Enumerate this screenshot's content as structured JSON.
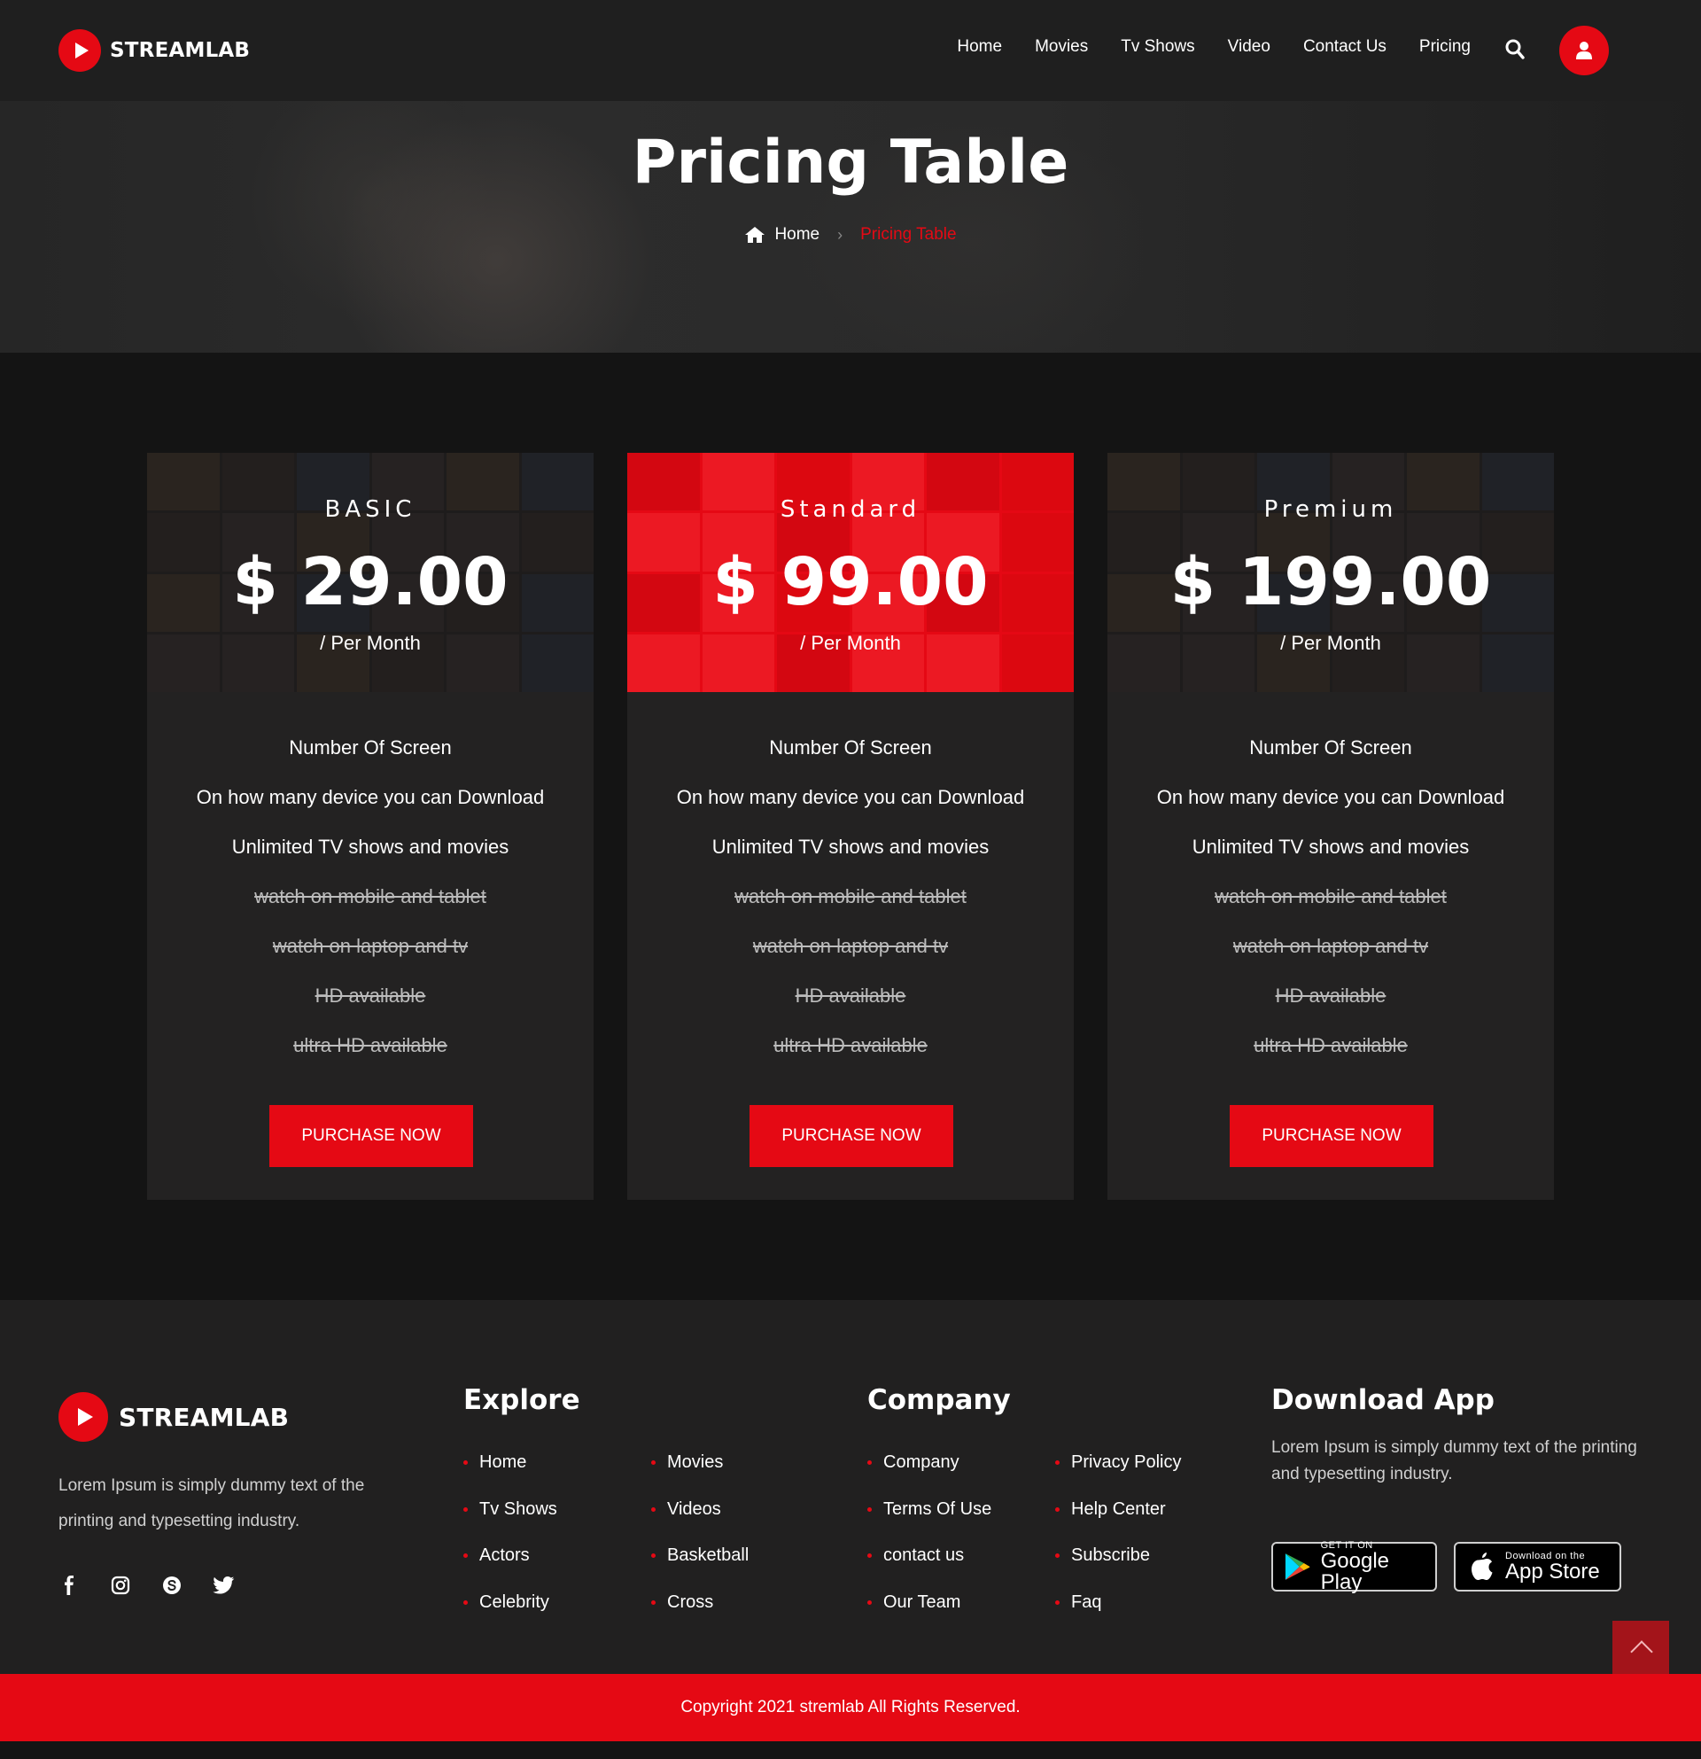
{
  "brand": {
    "name": "STREAMLAB"
  },
  "nav": {
    "items": [
      "Home",
      "Movies",
      "Tv Shows",
      "Video",
      "Contact Us",
      "Pricing"
    ]
  },
  "hero": {
    "title": "Pricing Table",
    "breadcrumb": {
      "home": "Home",
      "current": "Pricing Table"
    }
  },
  "plans": [
    {
      "name": "BASIC",
      "price": "$ 29.00",
      "period": "/ Per Month",
      "features": [
        {
          "text": "Number Of Screen",
          "enabled": true
        },
        {
          "text": "On how many device you can Download",
          "enabled": true
        },
        {
          "text": "Unlimited TV shows and movies",
          "enabled": true
        },
        {
          "text": "watch on mobile and tablet",
          "enabled": false
        },
        {
          "text": "watch on laptop and tv",
          "enabled": false
        },
        {
          "text": "HD available",
          "enabled": false
        },
        {
          "text": "ultra HD available",
          "enabled": false
        }
      ],
      "button": "PURCHASE NOW",
      "highlight": false
    },
    {
      "name": "Standard",
      "price": "$ 99.00",
      "period": "/ Per Month",
      "features": [
        {
          "text": "Number Of Screen",
          "enabled": true
        },
        {
          "text": "On how many device you can Download",
          "enabled": true
        },
        {
          "text": "Unlimited TV shows and movies",
          "enabled": true
        },
        {
          "text": "watch on mobile and tablet",
          "enabled": false
        },
        {
          "text": "watch on laptop and tv",
          "enabled": false
        },
        {
          "text": "HD available",
          "enabled": false
        },
        {
          "text": "ultra HD available",
          "enabled": false
        }
      ],
      "button": "PURCHASE NOW",
      "highlight": true
    },
    {
      "name": "Premium",
      "price": "$ 199.00",
      "period": "/ Per Month",
      "features": [
        {
          "text": "Number Of Screen",
          "enabled": true
        },
        {
          "text": "On how many device you can Download",
          "enabled": true
        },
        {
          "text": "Unlimited TV shows and movies",
          "enabled": true
        },
        {
          "text": "watch on mobile and tablet",
          "enabled": false
        },
        {
          "text": "watch on laptop and tv",
          "enabled": false
        },
        {
          "text": "HD available",
          "enabled": false
        },
        {
          "text": "ultra HD available",
          "enabled": false
        }
      ],
      "button": "PURCHASE NOW",
      "highlight": false
    }
  ],
  "footer": {
    "about": "Lorem Ipsum is simply dummy text of the printing and typesetting industry.",
    "socials": [
      "facebook-icon",
      "instagram-icon",
      "skype-icon",
      "twitter-icon"
    ],
    "explore": {
      "title": "Explore",
      "col1": [
        "Home",
        "Tv Shows",
        "Actors",
        "Celebrity"
      ],
      "col2": [
        "Movies",
        "Videos",
        "Basketball",
        "Cross"
      ]
    },
    "company": {
      "title": "Company",
      "col1": [
        "Company",
        "Terms Of Use",
        "contact us",
        "Our Team"
      ],
      "col2": [
        "Privacy Policy",
        "Help Center",
        "Subscribe",
        "Faq"
      ]
    },
    "app": {
      "title": "Download App",
      "text": "Lorem Ipsum is simply dummy text of the printing and typesetting industry.",
      "google": {
        "small": "GET IT ON",
        "big": "Google Play"
      },
      "apple": {
        "small": "Download on the",
        "big": "App Store"
      }
    },
    "copyright": "Copyright 2021 stremlab All Rights Reserved."
  },
  "colors": {
    "accent": "#e50914",
    "background": "#141414",
    "panel": "#232222"
  }
}
